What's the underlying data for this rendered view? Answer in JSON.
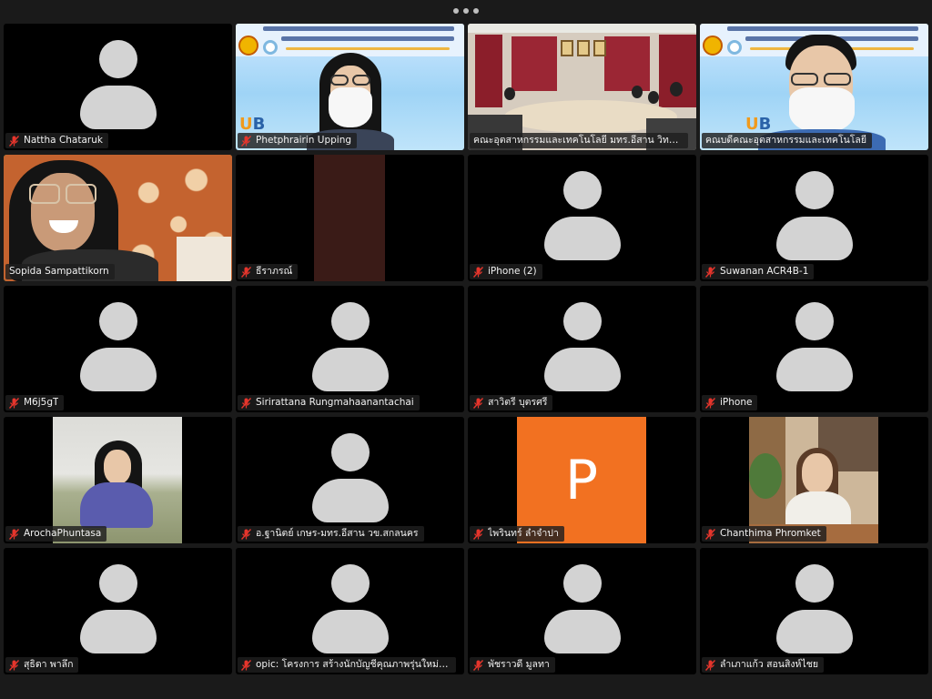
{
  "app": {
    "more_label": "More options"
  },
  "colors": {
    "active_speaker": "#2fc751",
    "tile_bg": "#000000",
    "avatar": "#d3d3d3",
    "letter_avatar": "#f27121"
  },
  "participants": [
    {
      "name": "Nattha Chataruk",
      "muted": true
    },
    {
      "name": "Phetphrairin  Upping",
      "muted": true
    },
    {
      "name": "คณะอุตสาหกรรมและเทคโนโลยี มทร.อีสาน วิทยาเขต...",
      "muted": false
    },
    {
      "name": "คณบดีคณะอุตสาหกรรมและเทคโนโลยี",
      "muted": false
    },
    {
      "name": "Sopida Sampattikorn",
      "muted": false,
      "active": true
    },
    {
      "name": "ธีราภรณ์",
      "muted": true
    },
    {
      "name": "iPhone (2)",
      "muted": true
    },
    {
      "name": "Suwanan ACR4B-1",
      "muted": true
    },
    {
      "name": "M6j5gT",
      "muted": true
    },
    {
      "name": "Sirirattana Rungmahaanantachai",
      "muted": true
    },
    {
      "name": "สาวิตรี บุตรศรี",
      "muted": true
    },
    {
      "name": "iPhone",
      "muted": true
    },
    {
      "name": "ArochaPhuntasa",
      "muted": true
    },
    {
      "name": "อ.ฐานิตย์ เกษร-มทร.อีสาน วข.สกลนคร",
      "muted": true
    },
    {
      "name": "ไพรินทร์ ลำจำปา",
      "muted": true,
      "initial": "P"
    },
    {
      "name": "Chanthima Phromket",
      "muted": true
    },
    {
      "name": "สุธิดา พาลึก",
      "muted": true
    },
    {
      "name": "opic: โครงการ สร้างนักบัญชีคุณภาพรุ่นใหม่ (You...",
      "muted": true
    },
    {
      "name": "พัชราวดี มูลทา",
      "muted": true
    },
    {
      "name": "ลำเภาแก้ว สอนสิงห์ไชย",
      "muted": true
    }
  ],
  "icons": {
    "mic_muted": "mic-off-icon",
    "more": "more-dots-icon"
  }
}
